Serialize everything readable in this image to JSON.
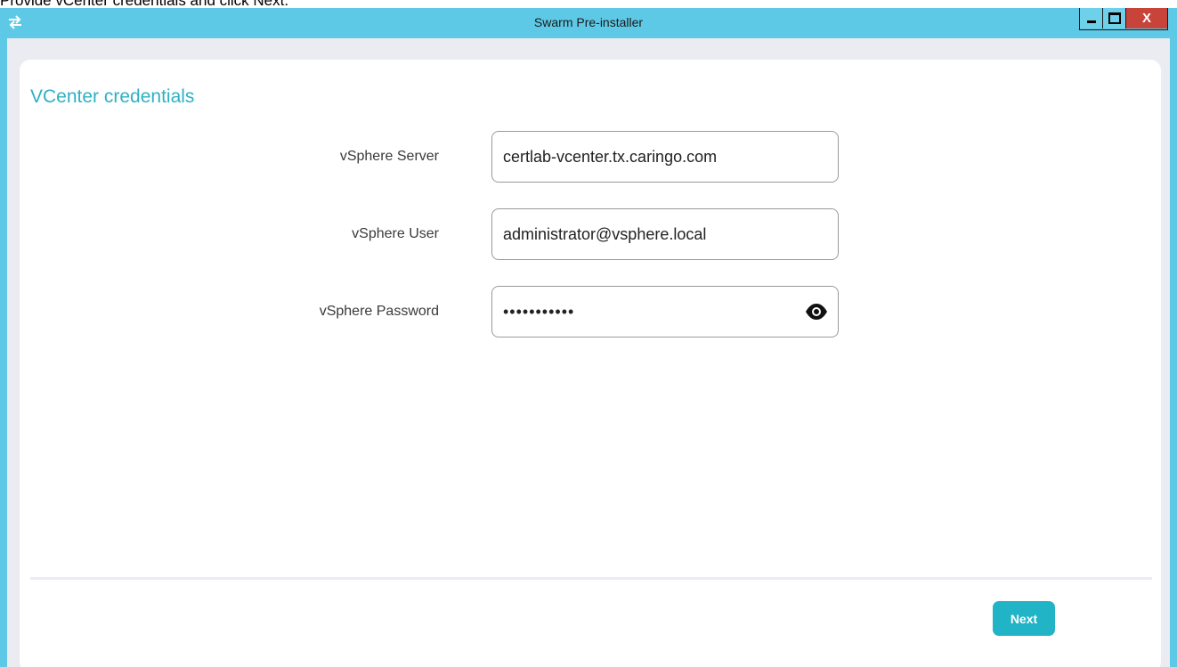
{
  "instruction": "Provide vCenter credentials and click Next.",
  "window": {
    "title": "Swarm Pre-installer",
    "controls": {
      "minimize": "minimize",
      "maximize": "maximize",
      "close_label": "X"
    }
  },
  "form": {
    "heading": "VCenter credentials",
    "fields": [
      {
        "label": "vSphere Server",
        "value": "certlab-vcenter.tx.caringo.com"
      },
      {
        "label": "vSphere User",
        "value": "administrator@vsphere.local"
      },
      {
        "label": "vSphere Password",
        "value": "•••••••••••"
      }
    ]
  },
  "footer": {
    "next_label": "Next"
  },
  "icons": {
    "app": "swap-arrows-icon",
    "password_toggle": "eye-icon"
  },
  "colors": {
    "titlebar": "#5ec9e6",
    "accent": "#21b3c6",
    "heading": "#2fb0c4",
    "close": "#c8443b"
  }
}
